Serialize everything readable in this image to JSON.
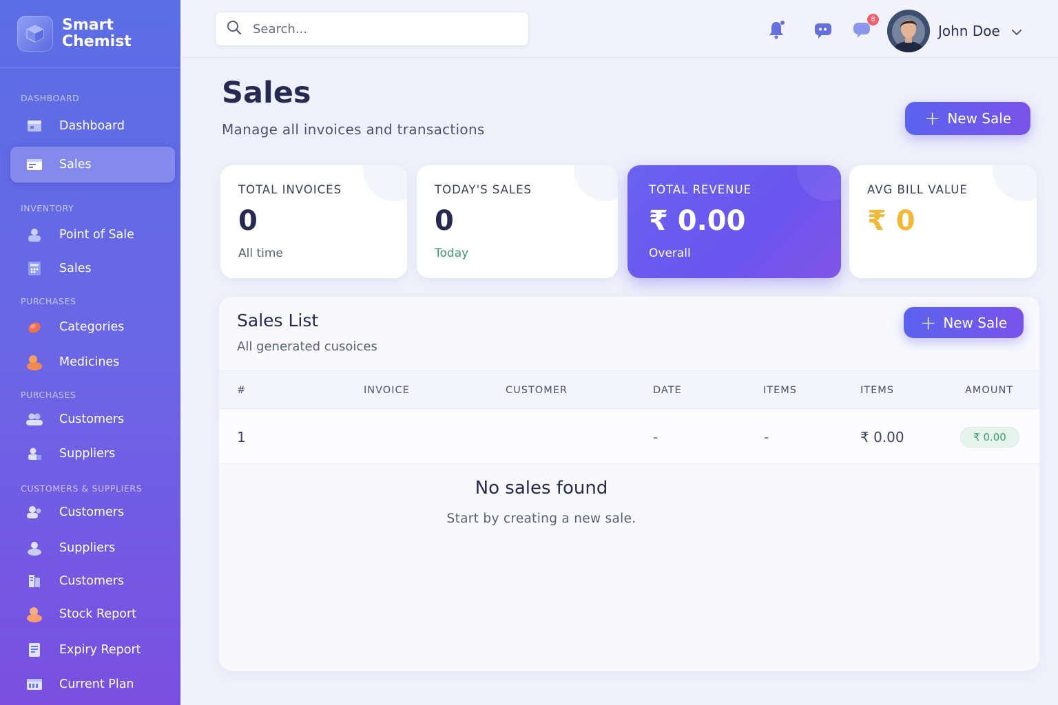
{
  "brand": {
    "name": "Smart\nChemist"
  },
  "sidebar": {
    "sections": [
      {
        "label": "DASHBOARD"
      },
      {
        "label": "INVENTORY"
      },
      {
        "label": "PURCHASES"
      },
      {
        "label": "PURCHASES"
      },
      {
        "label": "CUSTOMERS & SUPPLIERS"
      }
    ],
    "items": [
      {
        "label": "Dashboard",
        "icon": "dashboard-icon"
      },
      {
        "label": "Sales",
        "icon": "sales-icon",
        "active": true
      },
      {
        "label": "Point of Sale",
        "icon": "point-of-sale-icon"
      },
      {
        "label": "Sales",
        "icon": "calculator-icon"
      },
      {
        "label": "Categories",
        "icon": "categories-icon"
      },
      {
        "label": "Medicines",
        "icon": "medicines-icon"
      },
      {
        "label": "Customers",
        "icon": "customers-icon"
      },
      {
        "label": "Suppliers",
        "icon": "suppliers-icon"
      },
      {
        "label": "Customers",
        "icon": "customers-icon"
      },
      {
        "label": "Suppliers",
        "icon": "suppliers-icon"
      },
      {
        "label": "Customers",
        "icon": "customers-report-icon"
      },
      {
        "label": "Stock Report",
        "icon": "stock-report-icon"
      },
      {
        "label": "Expiry Report",
        "icon": "expiry-report-icon"
      },
      {
        "label": "Current Plan",
        "icon": "current-plan-icon"
      }
    ]
  },
  "topbar": {
    "search_placeholder": "Search...",
    "notification_badge": "8",
    "user_name": "John Doe"
  },
  "page": {
    "title": "Sales",
    "subtitle": "Manage all invoices and transactions",
    "new_sale_label": "New Sale"
  },
  "stats": [
    {
      "label": "TOTAL INVOICES",
      "value": "0",
      "sub": "All time"
    },
    {
      "label": "TODAY'S SALES",
      "value": "0",
      "sub": "Today"
    },
    {
      "label": "TOTAL REVENUE",
      "value": "₹ 0.00",
      "sub": "Overall"
    },
    {
      "label": "AVG BILL VALUE",
      "value": "₹ 0",
      "sub": ""
    }
  ],
  "sales_list": {
    "title": "Sales List",
    "subtitle": "All generated cusoices",
    "new_sale_label": "New Sale",
    "columns": [
      "#",
      "INVOICE",
      "CUSTOMER",
      "DATE",
      "ITEMS",
      "ITEMS",
      "AMOUNT"
    ],
    "rows": [
      {
        "num": "1",
        "invoice": "",
        "customer": "",
        "date": "-",
        "items": "-",
        "items2": "₹ 0.00",
        "amount": "₹ 0.00"
      }
    ],
    "empty_title": "No sales found",
    "empty_subtitle": "Start by creating a new sale."
  },
  "colors": {
    "accent": "#5b63ee",
    "success": "#3a9a6c",
    "warning": "#f4b934",
    "badge": "#f06070"
  }
}
